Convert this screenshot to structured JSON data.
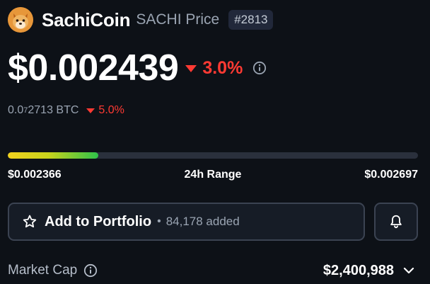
{
  "coin": {
    "name": "SachiCoin",
    "symbol_label": "SACHI Price",
    "rank": "#2813",
    "avatar_icon": "shiba-dog-avatar"
  },
  "price": {
    "value": "$0.002439",
    "change": "3.0%",
    "change_direction": "down",
    "change_color": "#ff3a33",
    "info_icon": "info-circle-icon"
  },
  "btc": {
    "prefix": "0.0",
    "zeros_subscript": "7",
    "digits": "2713 BTC",
    "change": "5.0%",
    "change_direction": "down"
  },
  "range": {
    "low": "$0.002366",
    "label": "24h Range",
    "high": "$0.002697",
    "position_fraction": 0.22
  },
  "portfolio": {
    "label": "Add to Portfolio",
    "separator": "•",
    "count": "84,178 added",
    "icon": "star-outline-icon"
  },
  "alert": {
    "icon": "bell-icon"
  },
  "market_cap": {
    "label": "Market Cap",
    "value": "$2,400,988",
    "info_icon": "info-circle-icon",
    "expand_icon": "chevron-down-icon"
  }
}
